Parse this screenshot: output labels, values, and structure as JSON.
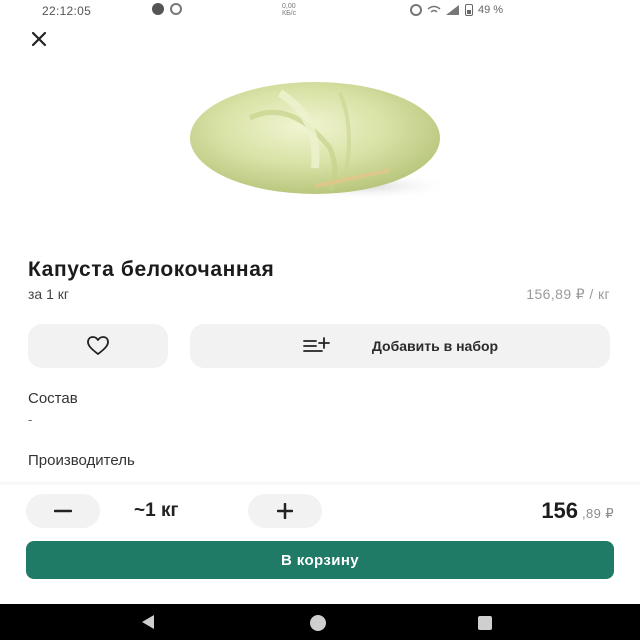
{
  "status_bar": {
    "time": "22:12:05",
    "network_speed_top": "0,00",
    "network_speed_bottom": "КБ/с",
    "battery_percent": "49 %",
    "icons": [
      "app-notification-icon",
      "sync-icon",
      "alarm-icon",
      "wifi-icon",
      "signal-icon",
      "battery-icon"
    ]
  },
  "header": {
    "close_icon": "close-icon"
  },
  "product": {
    "title": "Капуста белокочанная",
    "unit": "за 1 кг",
    "unit_price": "156,89 ₽ / кг",
    "image_icon": "cabbage-image"
  },
  "actions": {
    "favorite_icon": "heart-icon",
    "add_to_set_icon": "add-list-icon",
    "add_to_set_label": "Добавить в набор"
  },
  "details": {
    "composition_label": "Состав",
    "composition_value": "-",
    "manufacturer_label": "Производитель"
  },
  "quantity": {
    "minus_icon": "minus-icon",
    "value": "~1 кг",
    "plus_icon": "plus-icon"
  },
  "price": {
    "integer": "156",
    "fraction": ",89 ₽"
  },
  "cart": {
    "label": "В корзину",
    "color": "#1f7a66"
  },
  "nav": {
    "icons": [
      "back-icon",
      "home-icon",
      "recent-apps-icon"
    ]
  }
}
